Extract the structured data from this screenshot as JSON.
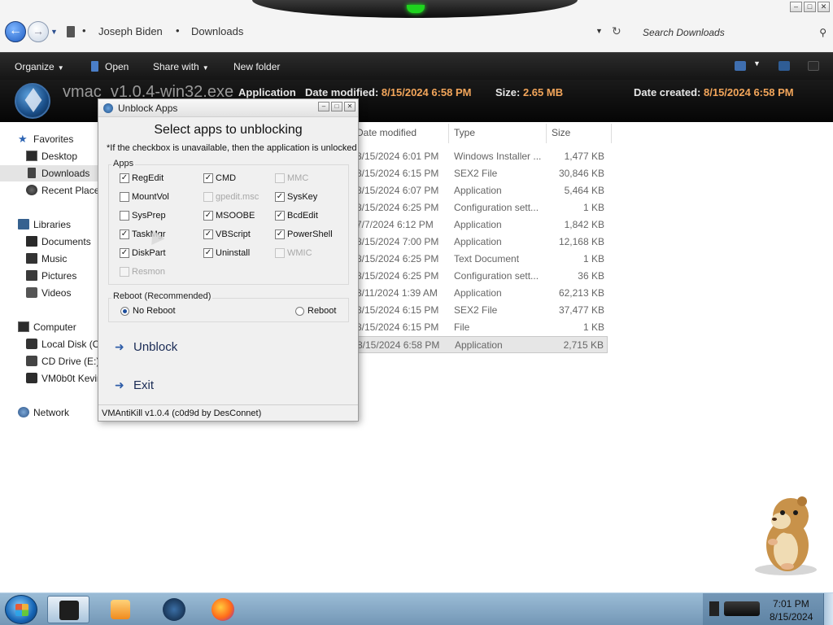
{
  "explorer": {
    "nav": {
      "back": "←",
      "forward": "→"
    },
    "breadcrumbs": [
      "Joseph Biden",
      "Downloads"
    ],
    "search": {
      "placeholder": "Search Downloads"
    },
    "toolbar": {
      "organize": "Organize",
      "open": "Open",
      "share_with": "Share with",
      "new_folder": "New folder"
    },
    "details": {
      "filename": "vmac_v1.0.4-win32.exe",
      "type": "Application",
      "date_modified_label": "Date modified:",
      "date_modified": "8/15/2024 6:58 PM",
      "size_label": "Size:",
      "size": "2.65 MB",
      "date_created_label": "Date created:",
      "date_created": "8/15/2024 6:58 PM"
    },
    "sidebar": {
      "favorites": "Favorites",
      "desktop": "Desktop",
      "downloads": "Downloads",
      "recent_places": "Recent Places",
      "libraries": "Libraries",
      "documents": "Documents",
      "music": "Music",
      "pictures": "Pictures",
      "videos": "Videos",
      "computer": "Computer",
      "local_disk": "Local Disk (C:)",
      "cd_drive": "CD Drive (E:)",
      "vm_drive": "VM0b0t Kevin",
      "network": "Network"
    },
    "columns": {
      "date_modified": "Date modified",
      "type": "Type",
      "size": "Size"
    },
    "files": [
      {
        "date": "8/15/2024 6:01 PM",
        "type": "Windows Installer ...",
        "size": "1,477 KB"
      },
      {
        "date": "8/15/2024 6:15 PM",
        "type": "SEX2 File",
        "size": "30,846 KB"
      },
      {
        "date": "8/15/2024 6:07 PM",
        "type": "Application",
        "size": "5,464 KB"
      },
      {
        "date": "8/15/2024 6:25 PM",
        "type": "Configuration sett...",
        "size": "1 KB"
      },
      {
        "date": "7/7/2024 6:12 PM",
        "type": "Application",
        "size": "1,842 KB"
      },
      {
        "date": "8/15/2024 7:00 PM",
        "type": "Application",
        "size": "12,168 KB"
      },
      {
        "date": "8/15/2024 6:25 PM",
        "type": "Text Document",
        "size": "1 KB"
      },
      {
        "date": "8/15/2024 6:25 PM",
        "type": "Configuration sett...",
        "size": "36 KB"
      },
      {
        "date": "3/11/2024 1:39 AM",
        "type": "Application",
        "size": "62,213 KB"
      },
      {
        "date": "8/15/2024 6:15 PM",
        "type": "SEX2 File",
        "size": "37,477 KB"
      },
      {
        "date": "8/15/2024 6:15 PM",
        "type": "File",
        "size": "1 KB"
      },
      {
        "date": "8/15/2024 6:58 PM",
        "type": "Application",
        "size": "2,715 KB"
      }
    ]
  },
  "dialog": {
    "title": "Unblock Apps",
    "heading": "Select apps to unblocking",
    "note": "*If the checkbox is unavailable, then the application is unlocked",
    "apps_group": "Apps",
    "apps": [
      {
        "label": "RegEdit",
        "checked": true,
        "enabled": true
      },
      {
        "label": "CMD",
        "checked": true,
        "enabled": true
      },
      {
        "label": "MMC",
        "checked": false,
        "enabled": false
      },
      {
        "label": "MountVol",
        "checked": false,
        "enabled": true
      },
      {
        "label": "gpedit.msc",
        "checked": false,
        "enabled": false
      },
      {
        "label": "SysKey",
        "checked": true,
        "enabled": true
      },
      {
        "label": "SysPrep",
        "checked": false,
        "enabled": true
      },
      {
        "label": "MSOOBE",
        "checked": true,
        "enabled": true
      },
      {
        "label": "BcdEdit",
        "checked": true,
        "enabled": true
      },
      {
        "label": "TaskMgr",
        "checked": true,
        "enabled": true
      },
      {
        "label": "VBScript",
        "checked": true,
        "enabled": true
      },
      {
        "label": "PowerShell",
        "checked": true,
        "enabled": true
      },
      {
        "label": "DiskPart",
        "checked": true,
        "enabled": true
      },
      {
        "label": "Uninstall",
        "checked": true,
        "enabled": true
      },
      {
        "label": "WMIC",
        "checked": false,
        "enabled": false
      },
      {
        "label": "Resmon",
        "checked": false,
        "enabled": false
      }
    ],
    "reboot_group": "Reboot (Recommended)",
    "no_reboot": "No Reboot",
    "reboot": "Reboot",
    "unblock": "Unblock",
    "exit": "Exit",
    "status": "VMAntiKill v1.0.4 (c0d9d by DesConnet)"
  },
  "taskbar": {
    "time": "7:01 PM",
    "date": "8/15/2024"
  },
  "colors": {
    "accent_orange": "#f2a55a",
    "toolbar_dark": "#151515",
    "taskbar": "#7e9fbe"
  }
}
